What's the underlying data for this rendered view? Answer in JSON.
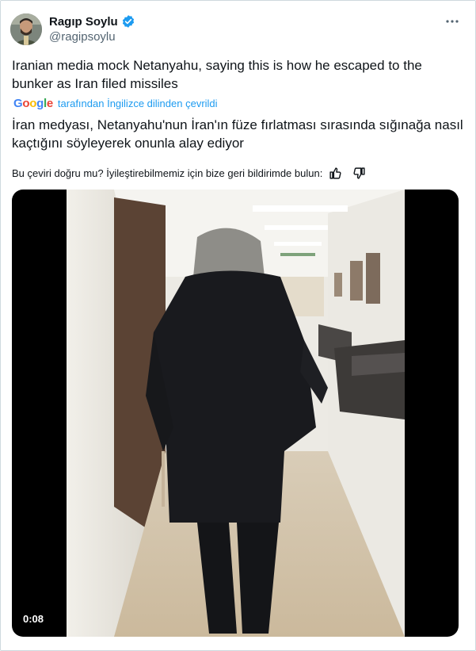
{
  "author": {
    "display_name": "Ragıp Soylu",
    "handle": "@ragipsoylu",
    "verified": true,
    "avatar_icon": "avatar-photo"
  },
  "menu": {
    "icon": "more-horizontal-icon"
  },
  "tweet": {
    "text": "Iranian media mock Netanyahu, saying this is how he escaped to the bunker as Iran filed missiles"
  },
  "translation": {
    "provider_logo": "Google",
    "label": "tarafından İngilizce dilinden çevrildi",
    "text": "İran medyası, Netanyahu'nun İran'ın füze fırlatması sırasında sığınağa nasıl kaçtığını söyleyerek onunla alay ediyor",
    "feedback_prompt": "Bu çeviri doğru mu? İyileştirebilmemiz için bize geri bildirimde bulun:",
    "thumbs_up_icon": "thumbs-up-icon",
    "thumbs_down_icon": "thumbs-down-icon"
  },
  "video": {
    "timestamp": "0:08"
  },
  "colors": {
    "text_primary": "#0f1419",
    "text_secondary": "#536471",
    "link_blue": "#1d9bf0",
    "verified_blue": "#1d9bf0",
    "border": "#cfd9de"
  }
}
